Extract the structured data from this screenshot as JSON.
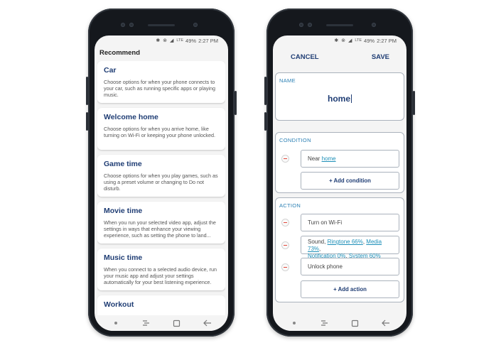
{
  "status_bar": {
    "icons": "✱ ⊗ ◢",
    "network": "LTE",
    "battery": "49%",
    "time": "2:27 PM"
  },
  "left_screen": {
    "header": "Recommend",
    "cards": [
      {
        "title": "Car",
        "description": "Choose options for when your phone connects to your car, such as running specific apps or playing music."
      },
      {
        "title": "Welcome home",
        "description": "Choose options for when you arrive home, like turning on Wi-Fi or keeping your phone unlocked."
      },
      {
        "title": "Game time",
        "description": "Choose options for when you play games, such as using a preset volume or changing to Do not disturb."
      },
      {
        "title": "Movie time",
        "description": "When you run your selected video app, adjust the settings in ways that enhance your viewing experience, such as setting the phone to land..."
      },
      {
        "title": "Music time",
        "description": "When you connect to a selected audio device, run your music app and adjust your settings automatically for your best listening experience."
      },
      {
        "title": "Workout",
        "description": ""
      }
    ]
  },
  "right_screen": {
    "cancel_label": "CANCEL",
    "save_label": "SAVE",
    "name_section": {
      "label": "NAME",
      "value": "home"
    },
    "condition_section": {
      "label": "CONDITION",
      "row_prefix": "Near ",
      "row_link": "home",
      "add_label": "+ Add condition"
    },
    "action_section": {
      "label": "ACTION",
      "wifi": "Turn on Wi-Fi",
      "sound_prefix": "Sound, ",
      "sound_ringtone": "Ringtone 66%",
      "sound_sep1": ", ",
      "sound_media": "Media 73%",
      "sound_sep2": ",",
      "sound_notification": "Notification 0%",
      "sound_sep3": ", ",
      "sound_system": "System 60%",
      "unlock": "Unlock phone",
      "add_label": "+ Add action"
    }
  },
  "colors": {
    "accent": "#1f3d74",
    "label_blue": "#2c80b4",
    "link": "#1d8fb8",
    "remove_red": "#e0463a"
  }
}
